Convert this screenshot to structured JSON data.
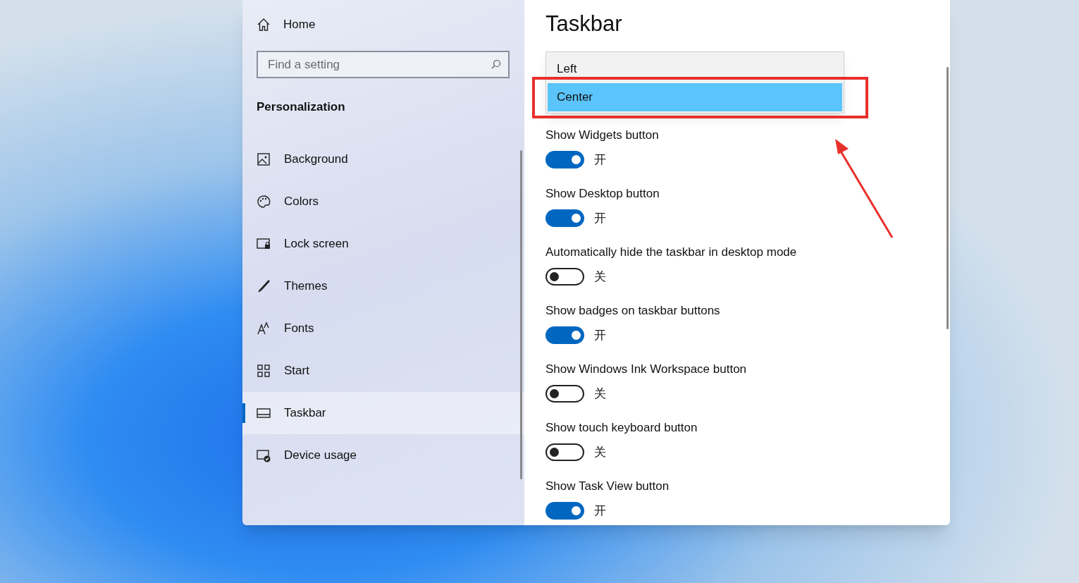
{
  "sidebar": {
    "home": "Home",
    "search": {
      "placeholder": "Find a setting"
    },
    "section": "Personalization",
    "items": [
      {
        "label": "Background",
        "selected": false
      },
      {
        "label": "Colors",
        "selected": false
      },
      {
        "label": "Lock screen",
        "selected": false
      },
      {
        "label": "Themes",
        "selected": false
      },
      {
        "label": "Fonts",
        "selected": false
      },
      {
        "label": "Start",
        "selected": false
      },
      {
        "label": "Taskbar",
        "selected": true
      },
      {
        "label": "Device usage",
        "selected": false
      }
    ]
  },
  "main": {
    "title": "Taskbar",
    "dropdown_options": [
      {
        "label": "Left",
        "selected": false
      },
      {
        "label": "Center",
        "selected": true
      }
    ],
    "settings": [
      {
        "label": "Show Widgets button",
        "on": true,
        "state_text": "开"
      },
      {
        "label": "Show Desktop button",
        "on": true,
        "state_text": "开"
      },
      {
        "label": "Automatically hide the taskbar in desktop mode",
        "on": false,
        "state_text": "关"
      },
      {
        "label": "Show badges on taskbar buttons",
        "on": true,
        "state_text": "开"
      },
      {
        "label": "Show Windows Ink Workspace button",
        "on": false,
        "state_text": "关"
      },
      {
        "label": "Show touch keyboard button",
        "on": false,
        "state_text": "关"
      },
      {
        "label": "Show Task View button",
        "on": true,
        "state_text": "开"
      }
    ]
  }
}
